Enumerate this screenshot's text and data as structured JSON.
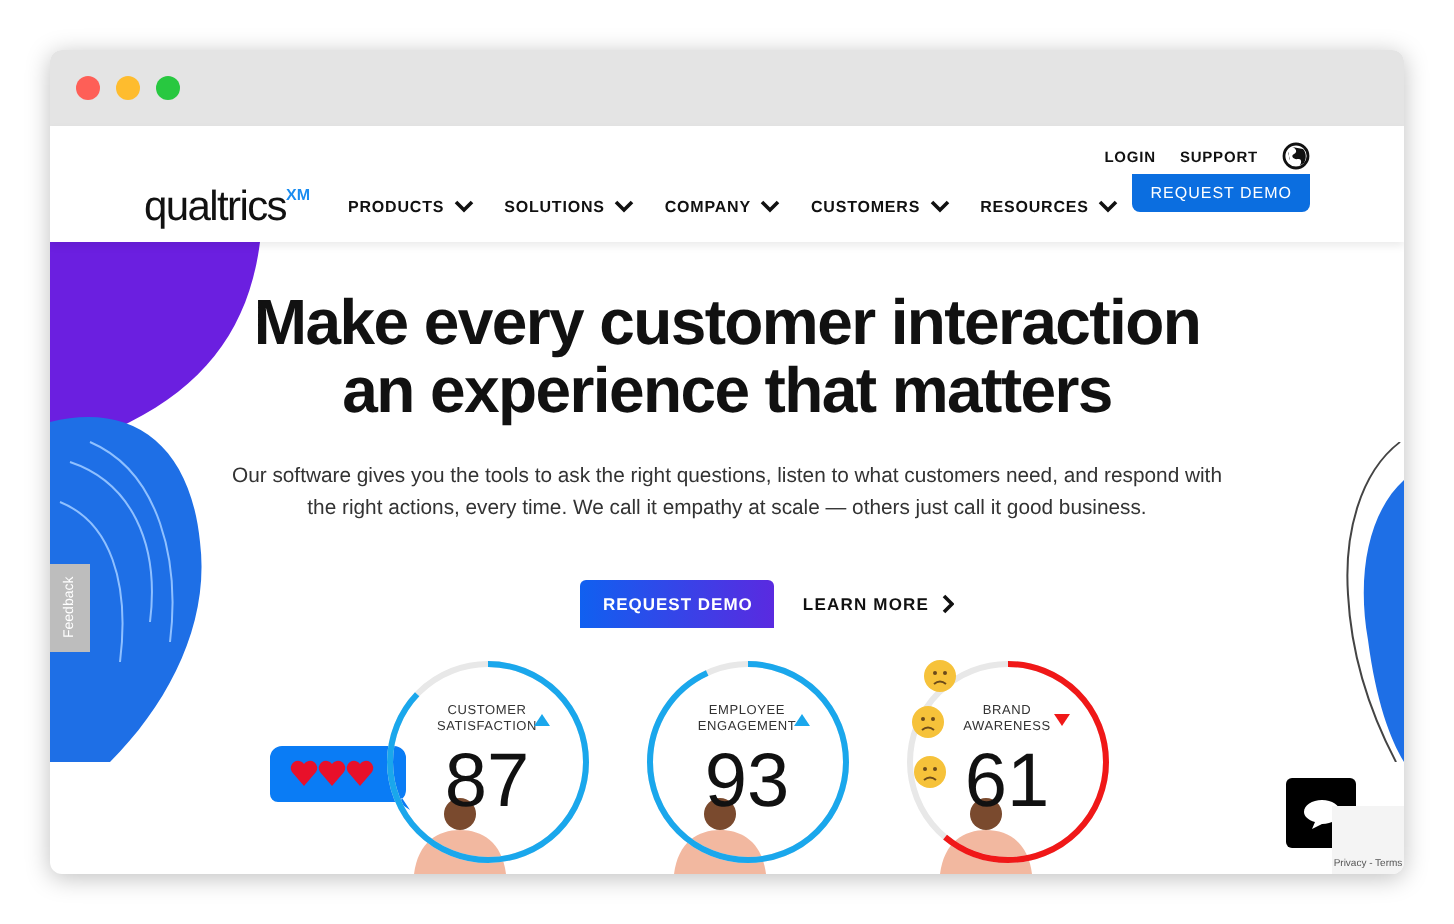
{
  "header": {
    "utility_links": [
      "LOGIN",
      "SUPPORT"
    ],
    "logo": {
      "name": "qualtrics",
      "suffix": "XM"
    },
    "nav": [
      {
        "label": "PRODUCTS"
      },
      {
        "label": "SOLUTIONS"
      },
      {
        "label": "COMPANY"
      },
      {
        "label": "CUSTOMERS"
      },
      {
        "label": "RESOURCES"
      }
    ],
    "cta": "REQUEST DEMO"
  },
  "hero": {
    "headline": [
      "Make every customer interaction",
      "an experience that matters"
    ],
    "body": "Our software gives you the tools to ask the right questions, listen to what customers need, and respond with the right actions, every time. We call it empathy at scale — others just call it good business.",
    "primary_button": "REQUEST DEMO",
    "secondary_link": "LEARN MORE",
    "gauges": [
      {
        "label": [
          "CUSTOMER",
          "SATISFACTION"
        ],
        "value": "87",
        "level": 0.87,
        "trend_up": true,
        "color": "#1aa7ec"
      },
      {
        "label": [
          "EMPLOYEE",
          "ENGAGEMENT"
        ],
        "value": "93",
        "level": 0.93,
        "trend_up": true,
        "color": "#1aa7ec"
      },
      {
        "label": [
          "BRAND",
          "AWARENESS"
        ],
        "value": "61",
        "level": 0.61,
        "trend_up": false,
        "color": "#f01818"
      }
    ]
  },
  "feedback_tab": "Feedback",
  "recaptcha": "Privacy - Terms"
}
